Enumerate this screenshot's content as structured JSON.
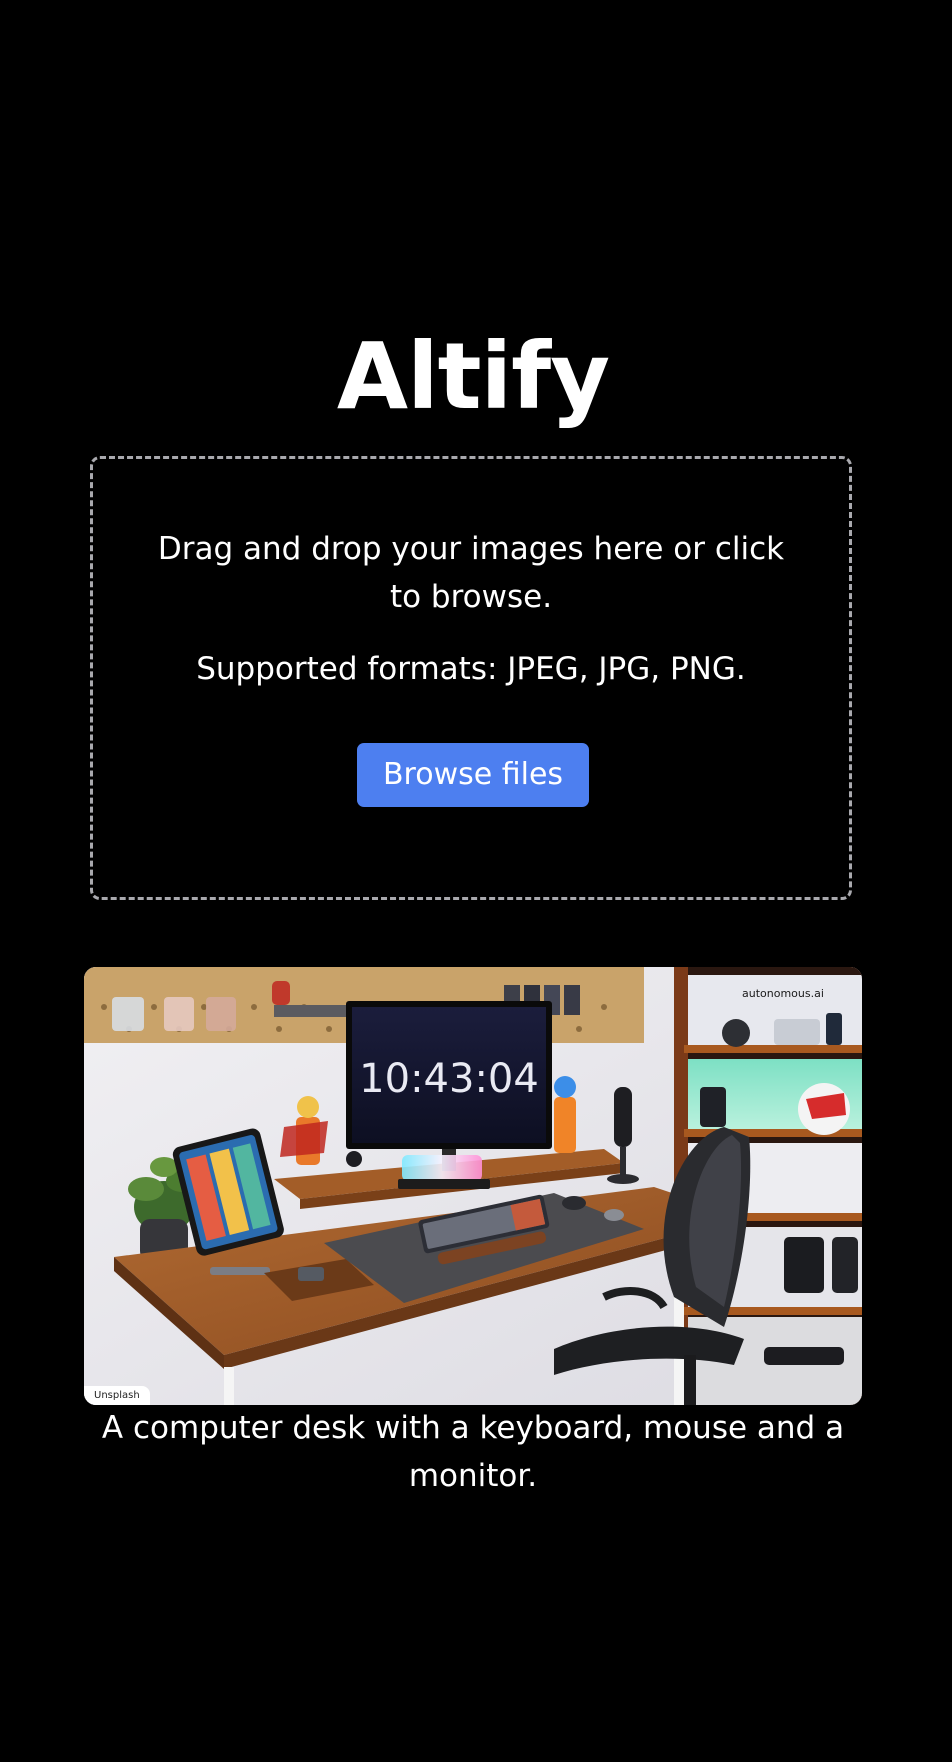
{
  "app": {
    "title": "Altify"
  },
  "upload": {
    "instructions": "Drag and drop your images here or click to browse.",
    "formats": "Supported formats: JPEG, JPG, PNG.",
    "browse_label": "Browse files",
    "accent_color": "#4d7ff0",
    "border_color": "#a9a9ae"
  },
  "result": {
    "image_credit": "Unsplash",
    "clock_text": "10:43:04",
    "brand_text": "autonomous.ai",
    "caption": "A computer desk with a keyboard, mouse and a monitor."
  }
}
